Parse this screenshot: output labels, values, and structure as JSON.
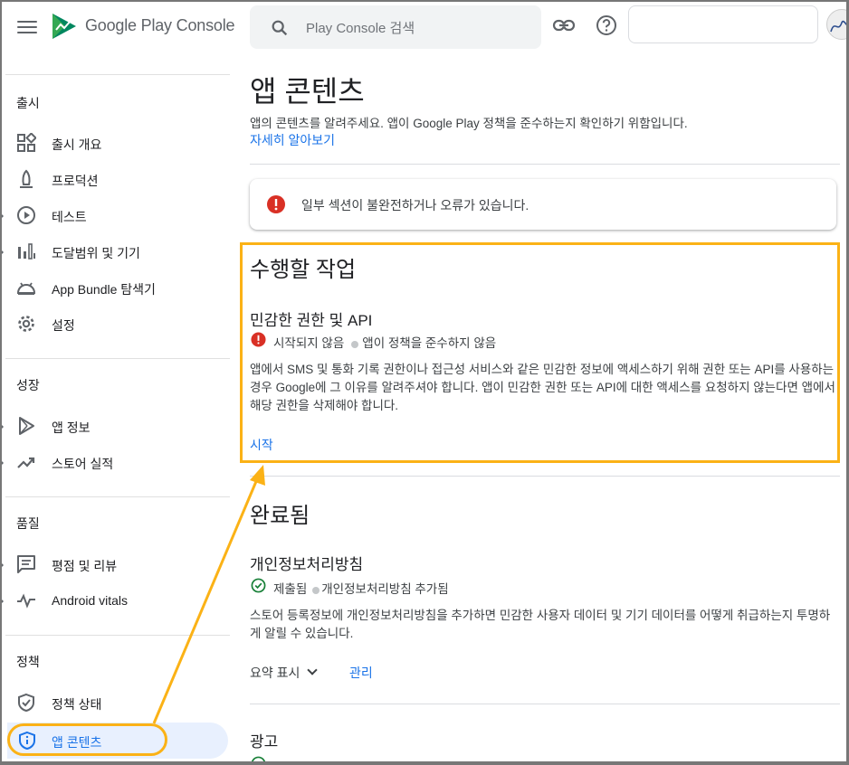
{
  "header": {
    "brand": "Google Play Console",
    "search_placeholder": "Play Console 검색"
  },
  "sidebar": {
    "sections": [
      {
        "title": "출시",
        "items": [
          {
            "label": "출시 개요",
            "icon": "dashboard-icon"
          },
          {
            "label": "프로덕션",
            "icon": "production-icon"
          },
          {
            "label": "테스트",
            "icon": "play-circle-icon"
          },
          {
            "label": "도달범위 및 기기",
            "icon": "bar-chart-icon"
          },
          {
            "label": "App Bundle 탐색기",
            "icon": "android-icon"
          },
          {
            "label": "설정",
            "icon": "gear-icon"
          }
        ]
      },
      {
        "title": "성장",
        "items": [
          {
            "label": "앱 정보",
            "icon": "play-store-icon"
          },
          {
            "label": "스토어 실적",
            "icon": "trending-up-icon"
          }
        ]
      },
      {
        "title": "품질",
        "items": [
          {
            "label": "평점 및 리뷰",
            "icon": "reviews-icon"
          },
          {
            "label": "Android vitals",
            "icon": "vitals-icon"
          }
        ]
      },
      {
        "title": "정책",
        "items": [
          {
            "label": "정책 상태",
            "icon": "shield-check-icon"
          },
          {
            "label": "앱 콘텐츠",
            "icon": "shield-info-icon"
          }
        ]
      }
    ]
  },
  "main": {
    "title": "앱 콘텐츠",
    "description": "앱의 콘텐츠를 알려주세요. 앱이 Google Play 정책을 준수하는지 확인하기 위함입니다.",
    "learn_more": "자세히 알아보기",
    "alert": "일부 섹션이 불완전하거나 오류가 있습니다.",
    "todo": {
      "heading": "수행할 작업",
      "item_title": "민감한 권한 및 API",
      "status": "시작되지 않음",
      "status_detail": "앱이 정책을 준수하지 않음",
      "paragraph": "앱에서 SMS 및 통화 기록 권한이나 접근성 서비스와 같은 민감한 정보에 액세스하기 위해 권한 또는 API를 사용하는 경우 Google에 그 이유를 알려주셔야 합니다. 앱이 민감한 권한 또는 API에 대한 액세스를 요청하지 않는다면 앱에서 해당 권한을 삭제해야 합니다.",
      "action": "시작"
    },
    "done": {
      "heading": "완료됨",
      "item_title": "개인정보처리방침",
      "status": "제출됨",
      "status_detail": "개인정보처리방침 추가됨",
      "paragraph": "스토어 등록정보에 개인정보처리방침을 추가하면 민감한 사용자 데이터 및 기기 데이터를 어떻게 취급하는지 투명하게 알릴 수 있습니다.",
      "summary": "요약 표시",
      "manage": "관리",
      "next_title": "광고"
    }
  },
  "colors": {
    "accent": "#1a73e8",
    "highlight": "#fbb216",
    "error": "#d93025",
    "success": "#188038"
  }
}
